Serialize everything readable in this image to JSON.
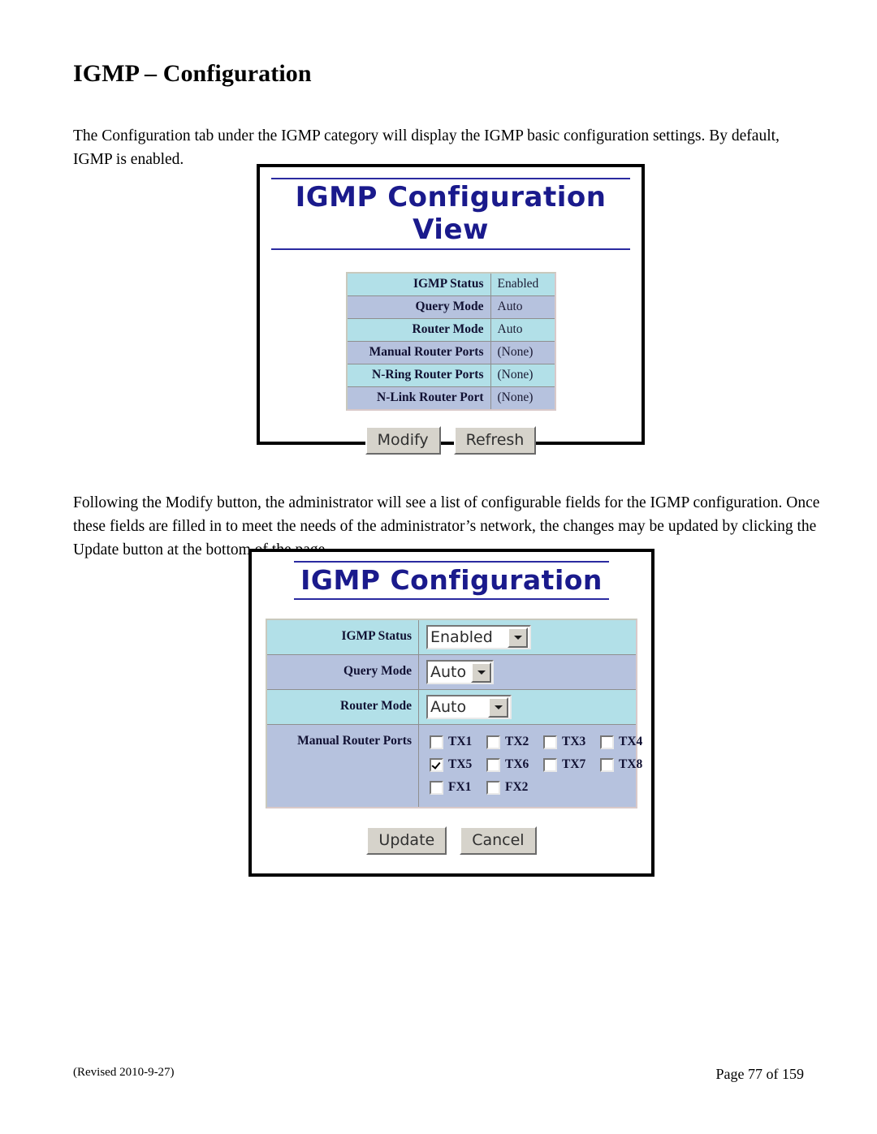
{
  "document": {
    "title": "IGMP – Configuration",
    "paragraph_1": "The Configuration tab under the IGMP category will display the IGMP basic configuration settings.  By default, IGMP is enabled.",
    "paragraph_2": "Following the Modify button, the administrator will see a list of configurable fields for the IGMP configuration.  Once these fields are filled in to meet the needs of the administrator’s network, the changes may be updated by clicking the Update button at the bottom of the page.",
    "footer_left": "(Revised 2010-9-27)",
    "footer_right": "Page 77 of 159"
  },
  "view_panel": {
    "title": "IGMP Configuration View",
    "rows": [
      {
        "label": "IGMP Status",
        "value": "Enabled"
      },
      {
        "label": "Query Mode",
        "value": "Auto"
      },
      {
        "label": "Router Mode",
        "value": "Auto"
      },
      {
        "label": "Manual Router Ports",
        "value": "(None)"
      },
      {
        "label": "N-Ring Router Ports",
        "value": "(None)"
      },
      {
        "label": "N-Link Router Port",
        "value": "(None)"
      }
    ],
    "buttons": {
      "modify": "Modify",
      "refresh": "Refresh"
    }
  },
  "config_panel": {
    "title": "IGMP Configuration",
    "fields": {
      "igmp_status": {
        "label": "IGMP Status",
        "value": "Enabled"
      },
      "query_mode": {
        "label": "Query Mode",
        "value": "Auto"
      },
      "router_mode": {
        "label": "Router Mode",
        "value": "Auto"
      },
      "manual_router_ports": {
        "label": "Manual Router Ports",
        "ports": [
          [
            {
              "name": "TX1",
              "checked": false
            },
            {
              "name": "TX2",
              "checked": false
            },
            {
              "name": "TX3",
              "checked": false
            },
            {
              "name": "TX4",
              "checked": false
            }
          ],
          [
            {
              "name": "TX5",
              "checked": true
            },
            {
              "name": "TX6",
              "checked": false
            },
            {
              "name": "TX7",
              "checked": false
            },
            {
              "name": "TX8",
              "checked": false
            }
          ],
          [
            {
              "name": "FX1",
              "checked": false
            },
            {
              "name": "FX2",
              "checked": false
            }
          ]
        ]
      }
    },
    "buttons": {
      "update": "Update",
      "cancel": "Cancel"
    }
  },
  "colors": {
    "heading_blue": "#1a1a8c",
    "row_cyan": "#b2e0e8",
    "row_blue": "#b6c2de",
    "button_face": "#d6d3cb"
  }
}
